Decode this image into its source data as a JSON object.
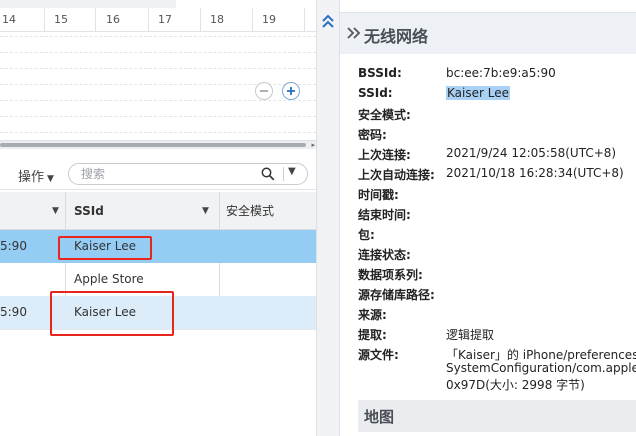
{
  "timeline": {
    "ruler_labels": [
      "14",
      "15",
      "16",
      "17",
      "18",
      "19"
    ],
    "zoom_out_icon": "minus-circle-icon",
    "zoom_in_icon": "plus-circle-icon"
  },
  "toolbar": {
    "operations_label": "操作",
    "search_placeholder": "搜索"
  },
  "table": {
    "columns": [
      "",
      "SSId",
      "安全模式"
    ],
    "rows": [
      {
        "mac_tail": "5:90",
        "ssid": "Kaiser Lee",
        "security": "",
        "state": "selected"
      },
      {
        "mac_tail": "",
        "ssid": "Apple Store",
        "security": "",
        "state": "normal"
      },
      {
        "mac_tail": "5:90",
        "ssid": "Kaiser Lee",
        "security": "",
        "state": "alternate"
      }
    ]
  },
  "detail": {
    "title": "无线网络",
    "fields": [
      {
        "label": "BSSId:",
        "value": "bc:ee:7b:e9:a5:90"
      },
      {
        "label": "SSId:",
        "value": "Kaiser Lee"
      },
      {
        "label": "安全模式:",
        "value": ""
      },
      {
        "label": "密码:",
        "value": ""
      },
      {
        "label": "上次连接:",
        "value": "2021/9/24 12:05:58(UTC+8)"
      },
      {
        "label": "上次自动连接:",
        "value": "2021/10/18 16:28:34(UTC+8)"
      },
      {
        "label": "时间戳:",
        "value": ""
      },
      {
        "label": "结束时间:",
        "value": ""
      },
      {
        "label": "包:",
        "value": ""
      },
      {
        "label": "连接状态:",
        "value": ""
      },
      {
        "label": "数据项系列:",
        "value": ""
      },
      {
        "label": "源存储库路径:",
        "value": ""
      },
      {
        "label": "来源:",
        "value": ""
      },
      {
        "label": "提取:",
        "value": "逻辑提取"
      },
      {
        "label": "源文件:",
        "value": "「Kaiser」的 iPhone/preferences/"
      }
    ],
    "source_file_line2": "SystemConfiguration/com.apple.",
    "source_file_line3": "0x97D(大小: 2998 字节)",
    "map_title": "地图"
  },
  "colors": {
    "selected_row": "#95ccf4",
    "alternate_row": "#dcecf9",
    "highlight_box": "#e8251d",
    "text_highlight": "#a8d1f5"
  }
}
